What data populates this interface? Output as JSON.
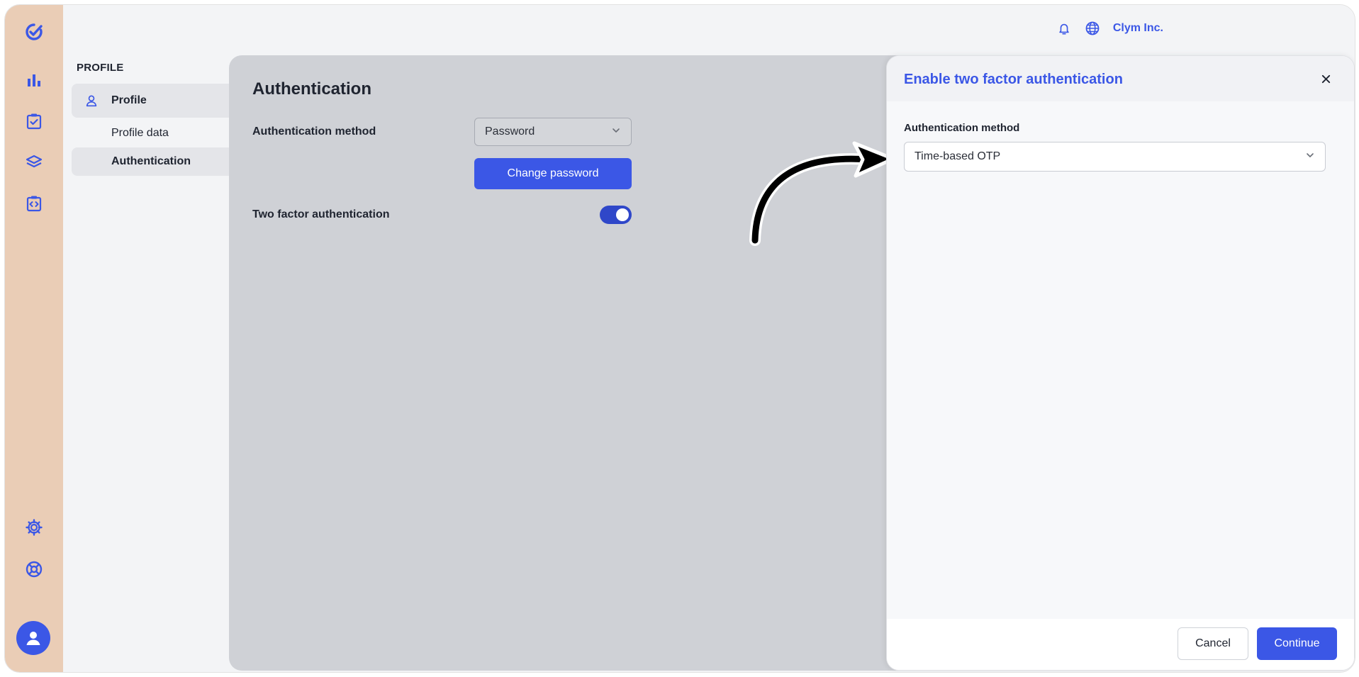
{
  "brand": {
    "accent": "#3b57e6",
    "rail_color": "#eacdb6"
  },
  "rail": {
    "icons": [
      "logo-icon",
      "chart-icon",
      "checklist-icon",
      "layers-icon",
      "code-clipboard-icon",
      "gear-icon",
      "lifebuoy-icon",
      "avatar-icon"
    ]
  },
  "topbar": {
    "company": "Clym Inc."
  },
  "subnav": {
    "section_title": "PROFILE",
    "profile_label": "Profile",
    "items": [
      {
        "label": "Profile data"
      },
      {
        "label": "Authentication"
      }
    ]
  },
  "content": {
    "title": "Authentication",
    "auth_method_label": "Authentication method",
    "auth_method_value": "Password",
    "change_password_label": "Change password",
    "two_factor_label": "Two factor authentication",
    "two_factor_enabled": true
  },
  "panel": {
    "title": "Enable two factor authentication",
    "field_label": "Authentication method",
    "field_value": "Time-based OTP",
    "cancel_label": "Cancel",
    "continue_label": "Continue"
  }
}
